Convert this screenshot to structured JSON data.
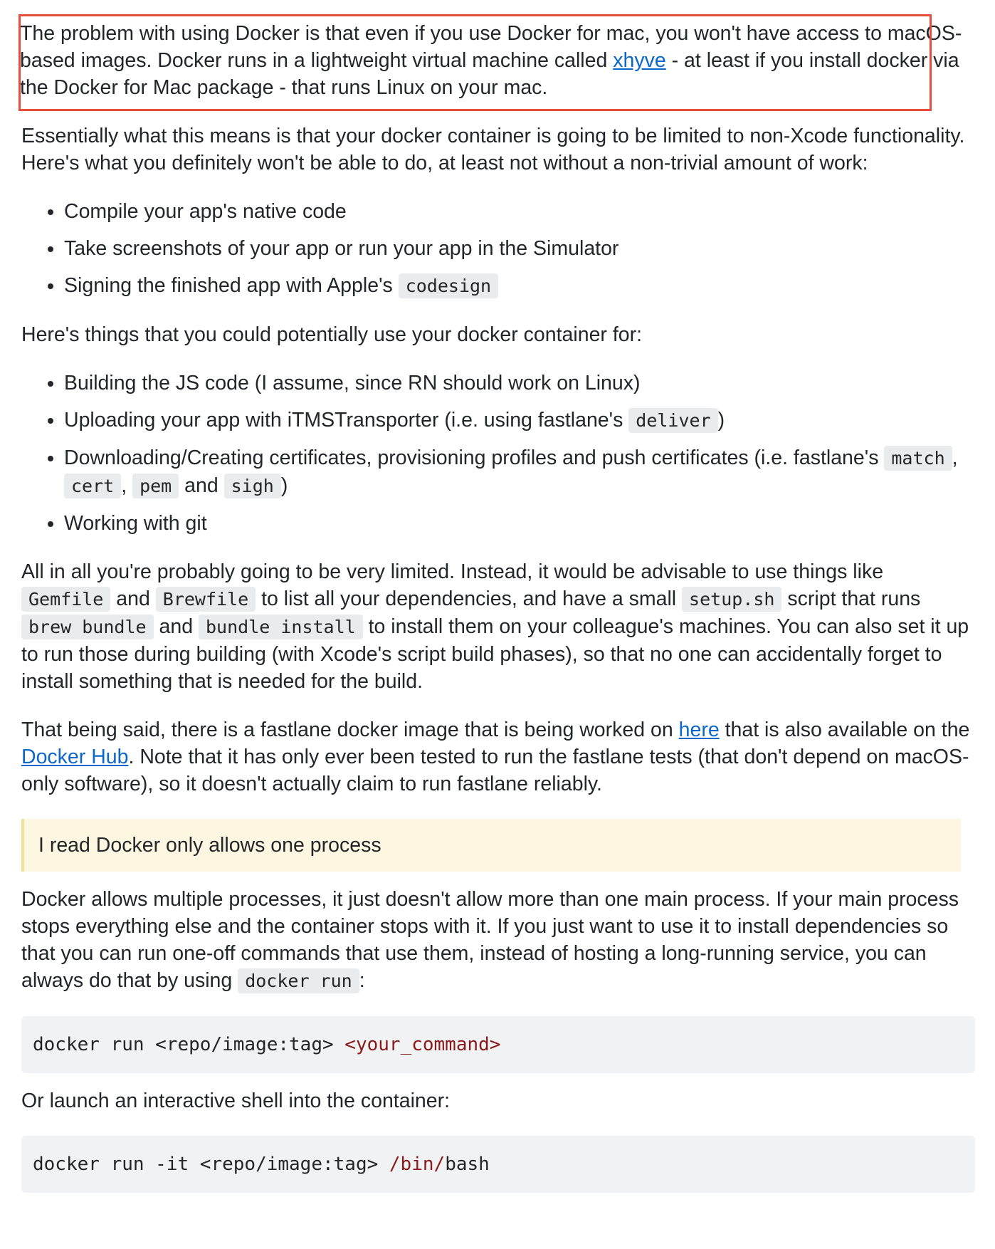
{
  "para1": {
    "before_link": "The problem with using Docker is that even if you use Docker for mac, you won't have access to macOS-based images. Docker runs in a lightweight virtual machine called ",
    "link": "xhyve",
    "after_link": " - at least if you install docker via the Docker for Mac package - that runs Linux on your mac."
  },
  "para2": "Essentially what this means is that your docker container is going to be limited to non-Xcode functionality. Here's what you definitely won't be able to do, at least not without a non-trivial amount of work:",
  "list1": [
    "Compile your app's native code",
    "Take screenshots of your app or run your app in the Simulator",
    "Signing the finished app with Apple's"
  ],
  "list1_code": "codesign",
  "para3": "Here's things that you could potentially use your docker container for:",
  "list2": {
    "item1": "Building the JS code (I assume, since RN should work on Linux)",
    "item2_text": "Uploading your app with iTMSTransporter (i.e. using fastlane's",
    "item2_code": "deliver",
    "item2_end": ")",
    "item3_text": "Downloading/Creating certificates, provisioning profiles and push certificates (i.e. fastlane's",
    "item3_code1": "match",
    "item3_code2": "cert",
    "item3_code3": "pem",
    "item3_and": "and",
    "item3_code4": "sigh",
    "item3_end": ")",
    "item4": "Working with git"
  },
  "para4": {
    "t1": "All in all you're probably going to be very limited. Instead, it would be advisable to use things like",
    "c1": "Gemfile",
    "t2": "and",
    "c2": "Brewfile",
    "t3": "to list all your dependencies, and have a small",
    "c3": "setup.sh",
    "t4": "script that runs",
    "c4": "brew bundle",
    "t5": "and",
    "c5": "bundle install",
    "t6": "to install them on your colleague's machines. You can also set it up to run those during building (with Xcode's script build phases), so that no one can accidentally forget to install something that is needed for the build."
  },
  "para5": {
    "t1": "That being said, there is a fastlane docker image that is being worked on ",
    "link1": "here",
    "t2": " that is also available on the ",
    "link2": "Docker Hub",
    "t3": ". Note that it has only ever been tested to run the fastlane tests (that don't depend on macOS-only software), so it doesn't actually claim to run fastlane reliably."
  },
  "quote": "I read Docker only allows one process",
  "para6": {
    "t1": "Docker allows multiple processes, it just doesn't allow more than one main process. If your main process stops everything else and the container stops with it. If you just want to use it to install dependencies so that you can run one-off commands that use them, instead of hosting a long-running service, you can always do that by using",
    "code": "docker run",
    "t2": ":"
  },
  "code1": {
    "plain": "docker run <repo/image:tag> ",
    "highlight": "<your_command>"
  },
  "para7": "Or launch an interactive shell into the container:",
  "code2": {
    "plain": "docker run -it <repo/image:tag> ",
    "highlight": "/bin/",
    "tail": "bash"
  }
}
